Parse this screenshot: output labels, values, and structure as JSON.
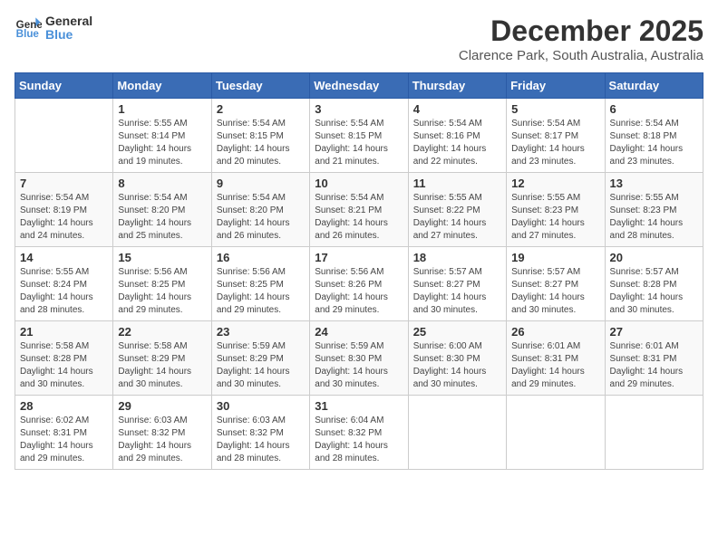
{
  "logo": {
    "general": "General",
    "blue": "Blue"
  },
  "title": "December 2025",
  "subtitle": "Clarence Park, South Australia, Australia",
  "headers": [
    "Sunday",
    "Monday",
    "Tuesday",
    "Wednesday",
    "Thursday",
    "Friday",
    "Saturday"
  ],
  "weeks": [
    [
      {
        "day": "",
        "info": ""
      },
      {
        "day": "1",
        "info": "Sunrise: 5:55 AM\nSunset: 8:14 PM\nDaylight: 14 hours\nand 19 minutes."
      },
      {
        "day": "2",
        "info": "Sunrise: 5:54 AM\nSunset: 8:15 PM\nDaylight: 14 hours\nand 20 minutes."
      },
      {
        "day": "3",
        "info": "Sunrise: 5:54 AM\nSunset: 8:15 PM\nDaylight: 14 hours\nand 21 minutes."
      },
      {
        "day": "4",
        "info": "Sunrise: 5:54 AM\nSunset: 8:16 PM\nDaylight: 14 hours\nand 22 minutes."
      },
      {
        "day": "5",
        "info": "Sunrise: 5:54 AM\nSunset: 8:17 PM\nDaylight: 14 hours\nand 23 minutes."
      },
      {
        "day": "6",
        "info": "Sunrise: 5:54 AM\nSunset: 8:18 PM\nDaylight: 14 hours\nand 23 minutes."
      }
    ],
    [
      {
        "day": "7",
        "info": "Sunrise: 5:54 AM\nSunset: 8:19 PM\nDaylight: 14 hours\nand 24 minutes."
      },
      {
        "day": "8",
        "info": "Sunrise: 5:54 AM\nSunset: 8:20 PM\nDaylight: 14 hours\nand 25 minutes."
      },
      {
        "day": "9",
        "info": "Sunrise: 5:54 AM\nSunset: 8:20 PM\nDaylight: 14 hours\nand 26 minutes."
      },
      {
        "day": "10",
        "info": "Sunrise: 5:54 AM\nSunset: 8:21 PM\nDaylight: 14 hours\nand 26 minutes."
      },
      {
        "day": "11",
        "info": "Sunrise: 5:55 AM\nSunset: 8:22 PM\nDaylight: 14 hours\nand 27 minutes."
      },
      {
        "day": "12",
        "info": "Sunrise: 5:55 AM\nSunset: 8:23 PM\nDaylight: 14 hours\nand 27 minutes."
      },
      {
        "day": "13",
        "info": "Sunrise: 5:55 AM\nSunset: 8:23 PM\nDaylight: 14 hours\nand 28 minutes."
      }
    ],
    [
      {
        "day": "14",
        "info": "Sunrise: 5:55 AM\nSunset: 8:24 PM\nDaylight: 14 hours\nand 28 minutes."
      },
      {
        "day": "15",
        "info": "Sunrise: 5:56 AM\nSunset: 8:25 PM\nDaylight: 14 hours\nand 29 minutes."
      },
      {
        "day": "16",
        "info": "Sunrise: 5:56 AM\nSunset: 8:25 PM\nDaylight: 14 hours\nand 29 minutes."
      },
      {
        "day": "17",
        "info": "Sunrise: 5:56 AM\nSunset: 8:26 PM\nDaylight: 14 hours\nand 29 minutes."
      },
      {
        "day": "18",
        "info": "Sunrise: 5:57 AM\nSunset: 8:27 PM\nDaylight: 14 hours\nand 30 minutes."
      },
      {
        "day": "19",
        "info": "Sunrise: 5:57 AM\nSunset: 8:27 PM\nDaylight: 14 hours\nand 30 minutes."
      },
      {
        "day": "20",
        "info": "Sunrise: 5:57 AM\nSunset: 8:28 PM\nDaylight: 14 hours\nand 30 minutes."
      }
    ],
    [
      {
        "day": "21",
        "info": "Sunrise: 5:58 AM\nSunset: 8:28 PM\nDaylight: 14 hours\nand 30 minutes."
      },
      {
        "day": "22",
        "info": "Sunrise: 5:58 AM\nSunset: 8:29 PM\nDaylight: 14 hours\nand 30 minutes."
      },
      {
        "day": "23",
        "info": "Sunrise: 5:59 AM\nSunset: 8:29 PM\nDaylight: 14 hours\nand 30 minutes."
      },
      {
        "day": "24",
        "info": "Sunrise: 5:59 AM\nSunset: 8:30 PM\nDaylight: 14 hours\nand 30 minutes."
      },
      {
        "day": "25",
        "info": "Sunrise: 6:00 AM\nSunset: 8:30 PM\nDaylight: 14 hours\nand 30 minutes."
      },
      {
        "day": "26",
        "info": "Sunrise: 6:01 AM\nSunset: 8:31 PM\nDaylight: 14 hours\nand 29 minutes."
      },
      {
        "day": "27",
        "info": "Sunrise: 6:01 AM\nSunset: 8:31 PM\nDaylight: 14 hours\nand 29 minutes."
      }
    ],
    [
      {
        "day": "28",
        "info": "Sunrise: 6:02 AM\nSunset: 8:31 PM\nDaylight: 14 hours\nand 29 minutes."
      },
      {
        "day": "29",
        "info": "Sunrise: 6:03 AM\nSunset: 8:32 PM\nDaylight: 14 hours\nand 29 minutes."
      },
      {
        "day": "30",
        "info": "Sunrise: 6:03 AM\nSunset: 8:32 PM\nDaylight: 14 hours\nand 28 minutes."
      },
      {
        "day": "31",
        "info": "Sunrise: 6:04 AM\nSunset: 8:32 PM\nDaylight: 14 hours\nand 28 minutes."
      },
      {
        "day": "",
        "info": ""
      },
      {
        "day": "",
        "info": ""
      },
      {
        "day": "",
        "info": ""
      }
    ]
  ]
}
